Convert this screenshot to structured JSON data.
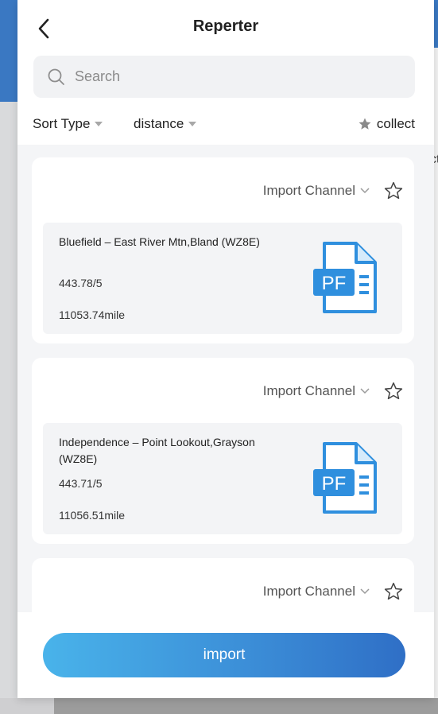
{
  "background": {
    "right_text": "ct"
  },
  "header": {
    "back_icon": "chevron-left-icon",
    "title": "Reperter"
  },
  "search": {
    "placeholder": "Search",
    "value": ""
  },
  "filters": {
    "sort_type_label": "Sort Type",
    "distance_label": "distance",
    "collect_label": "collect"
  },
  "cards": [
    {
      "import_channel_label": "Import Channel",
      "name": "Bluefield – East River Mtn,Bland (WZ8E)",
      "frequency": "443.78/5",
      "distance": "11053.74mile",
      "icon_text": "PF"
    },
    {
      "import_channel_label": "Import Channel",
      "name": "Independence – Point Lookout,Grayson (WZ8E)",
      "frequency": "443.71/5",
      "distance": "11056.51mile",
      "icon_text": "PF"
    },
    {
      "import_channel_label": "Import Channel"
    }
  ],
  "footer": {
    "import_label": "import"
  },
  "colors": {
    "accent_blue": "#3a78c2",
    "button_gradient_start": "#49b3ea",
    "button_gradient_end": "#2f6fc6",
    "pdf_icon_blue": "#2f8fde"
  }
}
